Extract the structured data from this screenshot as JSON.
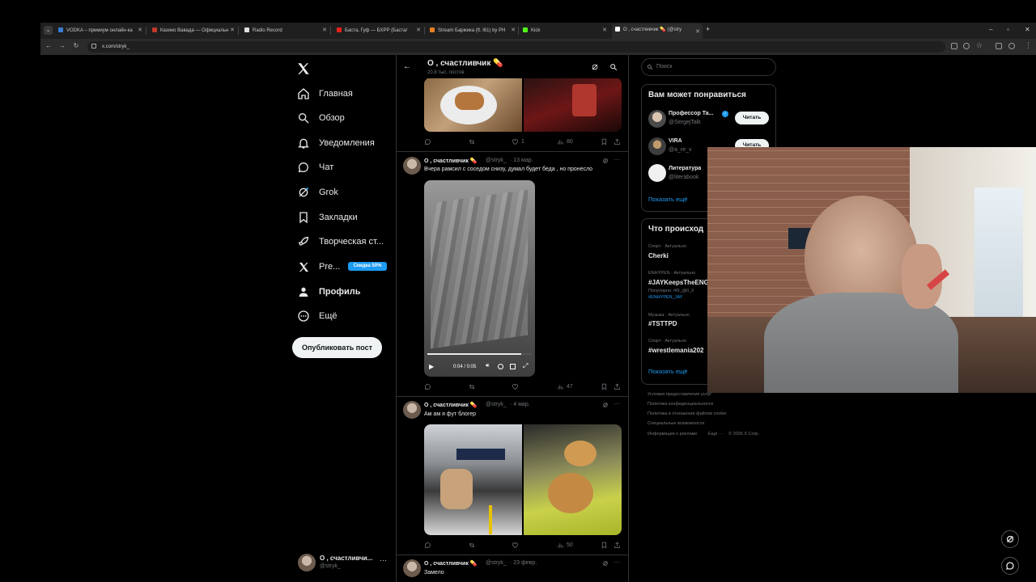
{
  "browser": {
    "tabs": [
      {
        "title": "VODKA – премиум онлайн-ка",
        "color": "#3a7bd5"
      },
      {
        "title": "Казино Вавада — Официальн",
        "color": "#c0392b"
      },
      {
        "title": "Radio Record",
        "color": "#e0e0e0"
      },
      {
        "title": "Баста, Гуф — БХРР (Баста/",
        "color": "#e62117"
      },
      {
        "title": "Stream Баржика (ft. l61) by PH",
        "color": "#e67e22"
      },
      {
        "title": "Kick",
        "color": "#53fc18"
      },
      {
        "title": "О , счастливчик 💊 (@stry",
        "color": "#ffffff"
      }
    ],
    "url": "x.com/stryk_"
  },
  "sidebar": {
    "items": [
      {
        "label": "Главная",
        "icon": "home-icon"
      },
      {
        "label": "Обзор",
        "icon": "search-icon"
      },
      {
        "label": "Уведомления",
        "icon": "bell-icon"
      },
      {
        "label": "Чат",
        "icon": "chat-icon"
      },
      {
        "label": "Grok",
        "icon": "grok-icon"
      },
      {
        "label": "Закладки",
        "icon": "bookmark-icon"
      },
      {
        "label": "Творческая ст...",
        "icon": "rocket-icon"
      },
      {
        "label": "Pre...",
        "icon": "x-logo-icon"
      },
      {
        "label": "Профиль",
        "icon": "person-icon"
      },
      {
        "label": "Ещё",
        "icon": "more-circle-icon"
      }
    ],
    "premium_badge": "Скидка 50%",
    "post_button": "Опубликовать пост",
    "account": {
      "name": "О , счастливчи...",
      "handle": "@stryk_"
    }
  },
  "header": {
    "title": "О , счастливчик 💊",
    "subtitle": "20,8 тыс. постов"
  },
  "tweets": [
    {
      "stats": {
        "reply": "",
        "retweet": "",
        "like": "1",
        "views": "80"
      }
    },
    {
      "name": "О , счастливчик 💊",
      "handle": "@stryk_",
      "date": "· 13 мар.",
      "text": "Вчера рамсил с соседом снизу, думал будет беда , но пронесло",
      "video_time": "0:04 / 0:05",
      "stats": {
        "reply": "",
        "retweet": "",
        "like": "",
        "views": "47"
      }
    },
    {
      "name": "О , счастливчик 💊",
      "handle": "@stryk_",
      "date": "· 4 мар.",
      "text": "Ам ам я фут блогер",
      "stats": {
        "reply": "",
        "retweet": "",
        "like": "",
        "views": "50"
      }
    },
    {
      "name": "О , счастливчик 💊",
      "handle": "@stryk_",
      "date": "· 23 февр.",
      "text": "Замело"
    }
  ],
  "right": {
    "search_placeholder": "Поиск",
    "who_to_follow": {
      "title": "Вам может понравиться",
      "users": [
        {
          "name": "Профессор Та...",
          "handle": "@SergejTalk",
          "button": "Читать"
        },
        {
          "name": "VIRA",
          "handle": "@a_re_v",
          "button": "Читать"
        },
        {
          "name": "Литература",
          "handle": "@literabook"
        }
      ],
      "show_more": "Показать ещё"
    },
    "trends": {
      "title": "Что происход",
      "items": [
        {
          "context": "Спорт · Актуально",
          "name": "Cherki"
        },
        {
          "context": "ENHYPEN · Актуально",
          "name": "#JAYKeepsTheENG",
          "extra1": "Популярно: #0I_@0_ll",
          "extra2": "#ENHYPEN_JAY"
        },
        {
          "context": "Музыка · Актуально",
          "name": "#TSTTPD"
        },
        {
          "context": "Спорт · Актуально",
          "name": "#wrestlemania202"
        }
      ],
      "show_more": "Показать ещё"
    },
    "footer": {
      "line1": "Условия предоставления услуг",
      "line2": "Политика конфиденциальности",
      "line3": "Политика в отношении файлов cookie",
      "line4": "Специальные возможности",
      "line5a": "Информация о рекламе",
      "line5b": "Ещё ···",
      "line5c": "© 2026 X Corp."
    }
  }
}
